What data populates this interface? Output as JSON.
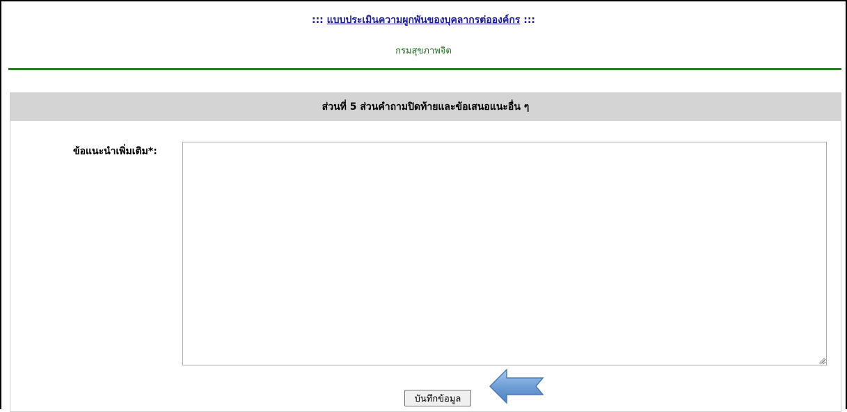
{
  "header": {
    "prefix": ":::",
    "title_link": "แบบประเมินความผูกพันของบุคลากรต่อองค์กร",
    "suffix": ":::",
    "subtitle": "กรมสุขภาพจิต"
  },
  "section": {
    "heading": "ส่วนที่ 5 ส่วนคำถามปิดท้ายและข้อเสนอแนะอื่น ๆ",
    "field_label": "ข้อแนะนำเพิ่มเติม*:",
    "comment_value": ""
  },
  "actions": {
    "save_label": "บันทึกข้อมูล"
  },
  "colors": {
    "title_link": "#1a1aa0",
    "subtitle": "#1a6b1a",
    "rule": "#2a7a2a",
    "section_header_bg": "#d4d4d4",
    "arrow_fill": "#6f9fd6"
  },
  "icons": {
    "pointer_arrow": "left-arrow-icon",
    "resize_grip": "resize-grip-icon"
  }
}
